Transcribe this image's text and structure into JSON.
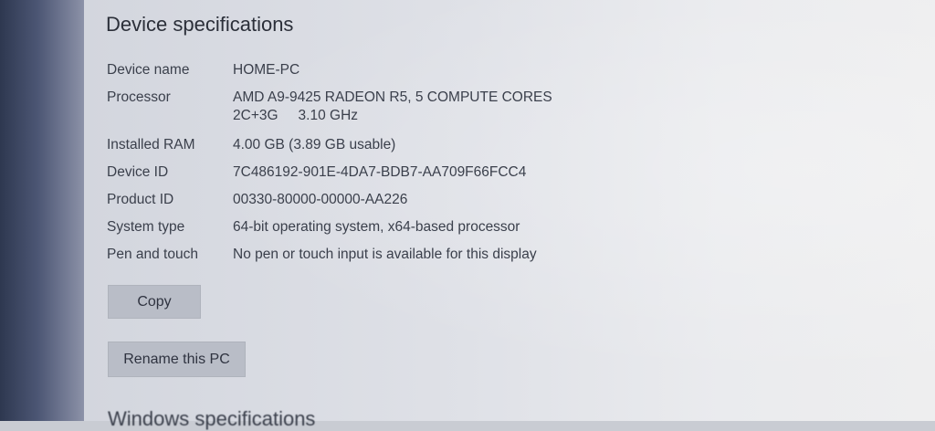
{
  "section": {
    "title": "Device specifications"
  },
  "specs": {
    "device_name": {
      "label": "Device name",
      "value": "HOME-PC"
    },
    "processor": {
      "label": "Processor",
      "value_line1": "AMD A9-9425 RADEON R5, 5 COMPUTE CORES",
      "value_line2_a": "2C+3G",
      "value_line2_b": "3.10 GHz"
    },
    "installed_ram": {
      "label": "Installed RAM",
      "value": "4.00 GB (3.89 GB usable)"
    },
    "device_id": {
      "label": "Device ID",
      "value": "7C486192-901E-4DA7-BDB7-AA709F66FCC4"
    },
    "product_id": {
      "label": "Product ID",
      "value": "00330-80000-00000-AA226"
    },
    "system_type": {
      "label": "System type",
      "value": "64-bit operating system, x64-based processor"
    },
    "pen_touch": {
      "label": "Pen and touch",
      "value": "No pen or touch input is available for this display"
    }
  },
  "buttons": {
    "copy": "Copy",
    "rename": "Rename this PC"
  },
  "next_section": {
    "title": "Windows specifications"
  }
}
